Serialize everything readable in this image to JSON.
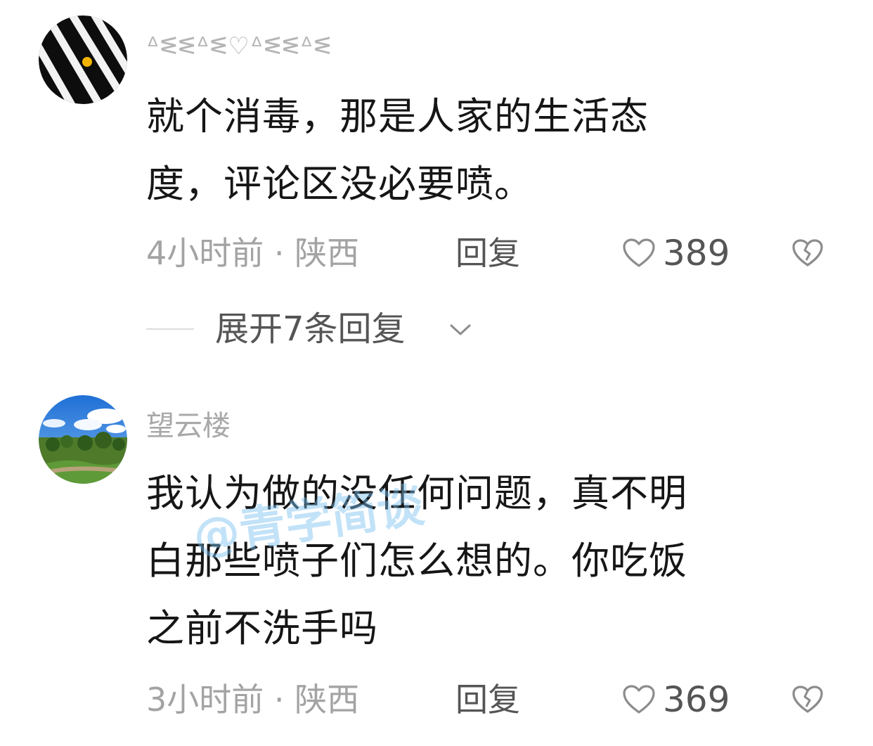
{
  "comments": [
    {
      "username": "ᐞᓬᓬᐞᓬ♡ᐞᓬᓬᐞᓬ",
      "text_lines": [
        "就个消毒，那是人家的生活态",
        "度，评论区没必要喷。"
      ],
      "time": "4小时前",
      "location": "陕西",
      "separator": "·",
      "reply_label": "回复",
      "likes": "389",
      "expand_label": "展开7条回复"
    },
    {
      "username": "望云楼",
      "text_lines": [
        "我认为做的没任何问题，真不明",
        "白那些喷子们怎么想的。你吃饭",
        "之前不洗手吗"
      ],
      "time": "3小时前",
      "location": "陕西",
      "separator": "·",
      "reply_label": "回复",
      "likes": "369"
    }
  ],
  "watermark": "@青学简谈",
  "colors": {
    "text": "#161616",
    "muted": "#a3a3a3",
    "action": "#555555"
  },
  "icons": {
    "like": "heart-outline-icon",
    "dislike": "broken-heart-icon",
    "expand": "chevron-down-icon"
  }
}
